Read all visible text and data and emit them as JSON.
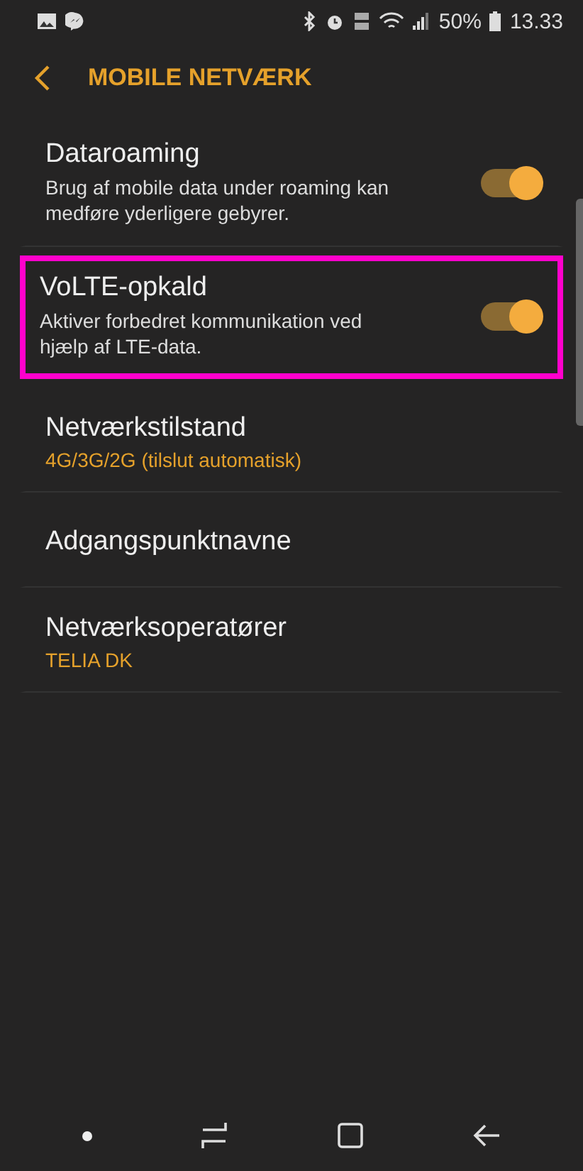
{
  "status_bar": {
    "battery": "50%",
    "time": "13.33"
  },
  "header": {
    "title": "MOBILE NETVÆRK"
  },
  "items": [
    {
      "kind": "toggle",
      "title": "Dataroaming",
      "summary": "Brug af mobile data under roaming kan medføre yderligere gebyrer.",
      "on": true,
      "highlighted": false
    },
    {
      "kind": "toggle",
      "title": "VoLTE-opkald",
      "summary": "Aktiver forbedret kommunikation ved hjælp af LTE-data.",
      "on": true,
      "highlighted": true
    },
    {
      "kind": "value",
      "title": "Netværkstilstand",
      "value": "4G/3G/2G (tilslut automatisk)"
    },
    {
      "kind": "plain",
      "title": "Adgangspunktnavne"
    },
    {
      "kind": "value",
      "title": "Netværksoperatører",
      "value": "TELIA DK"
    }
  ]
}
